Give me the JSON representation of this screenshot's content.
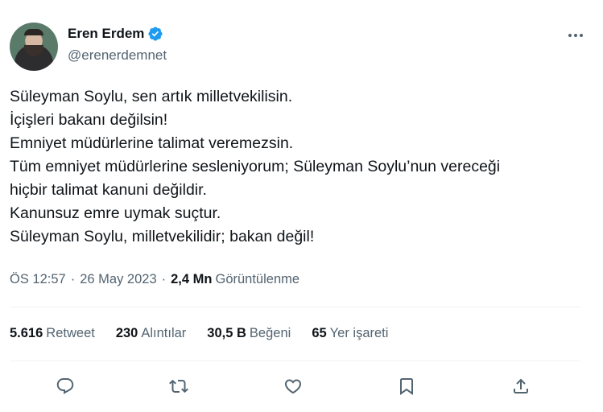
{
  "tweet": {
    "author": {
      "name": "Eren Erdem",
      "handle": "@erenerdemnet",
      "verified_color": "#1d9bf0"
    },
    "lines": [
      "Süleyman Soylu, sen artık milletvekilisin.",
      "İçişleri bakanı değilsin!",
      "Emniyet müdürlerine talimat veremezsin.",
      "Tüm emniyet müdürlerine sesleniyorum; Süleyman Soylu’nun vereceği",
      "hiçbir talimat kanuni değildir.",
      "Kanunsuz emre uymak suçtur.",
      "Süleyman Soylu, milletvekilidir; bakan değil!"
    ],
    "time": "ÖS 12:57",
    "date": "26 May 2023",
    "views_count": "2,4 Mn",
    "views_label": "Görüntülenme",
    "separator": "·"
  },
  "stats": {
    "retweets": {
      "count": "5.616",
      "label": "Retweet"
    },
    "quotes": {
      "count": "230",
      "label": "Alıntılar"
    },
    "likes": {
      "count": "30,5 B",
      "label": "Beğeni"
    },
    "bookmarks": {
      "count": "65",
      "label": "Yer işareti"
    }
  },
  "actions": [
    "reply-icon",
    "retweet-icon",
    "like-icon",
    "bookmark-icon",
    "share-icon"
  ],
  "colors": {
    "icon": "#536471",
    "text": "#0f1419",
    "secondary": "#536471",
    "divider": "#eff3f4"
  }
}
